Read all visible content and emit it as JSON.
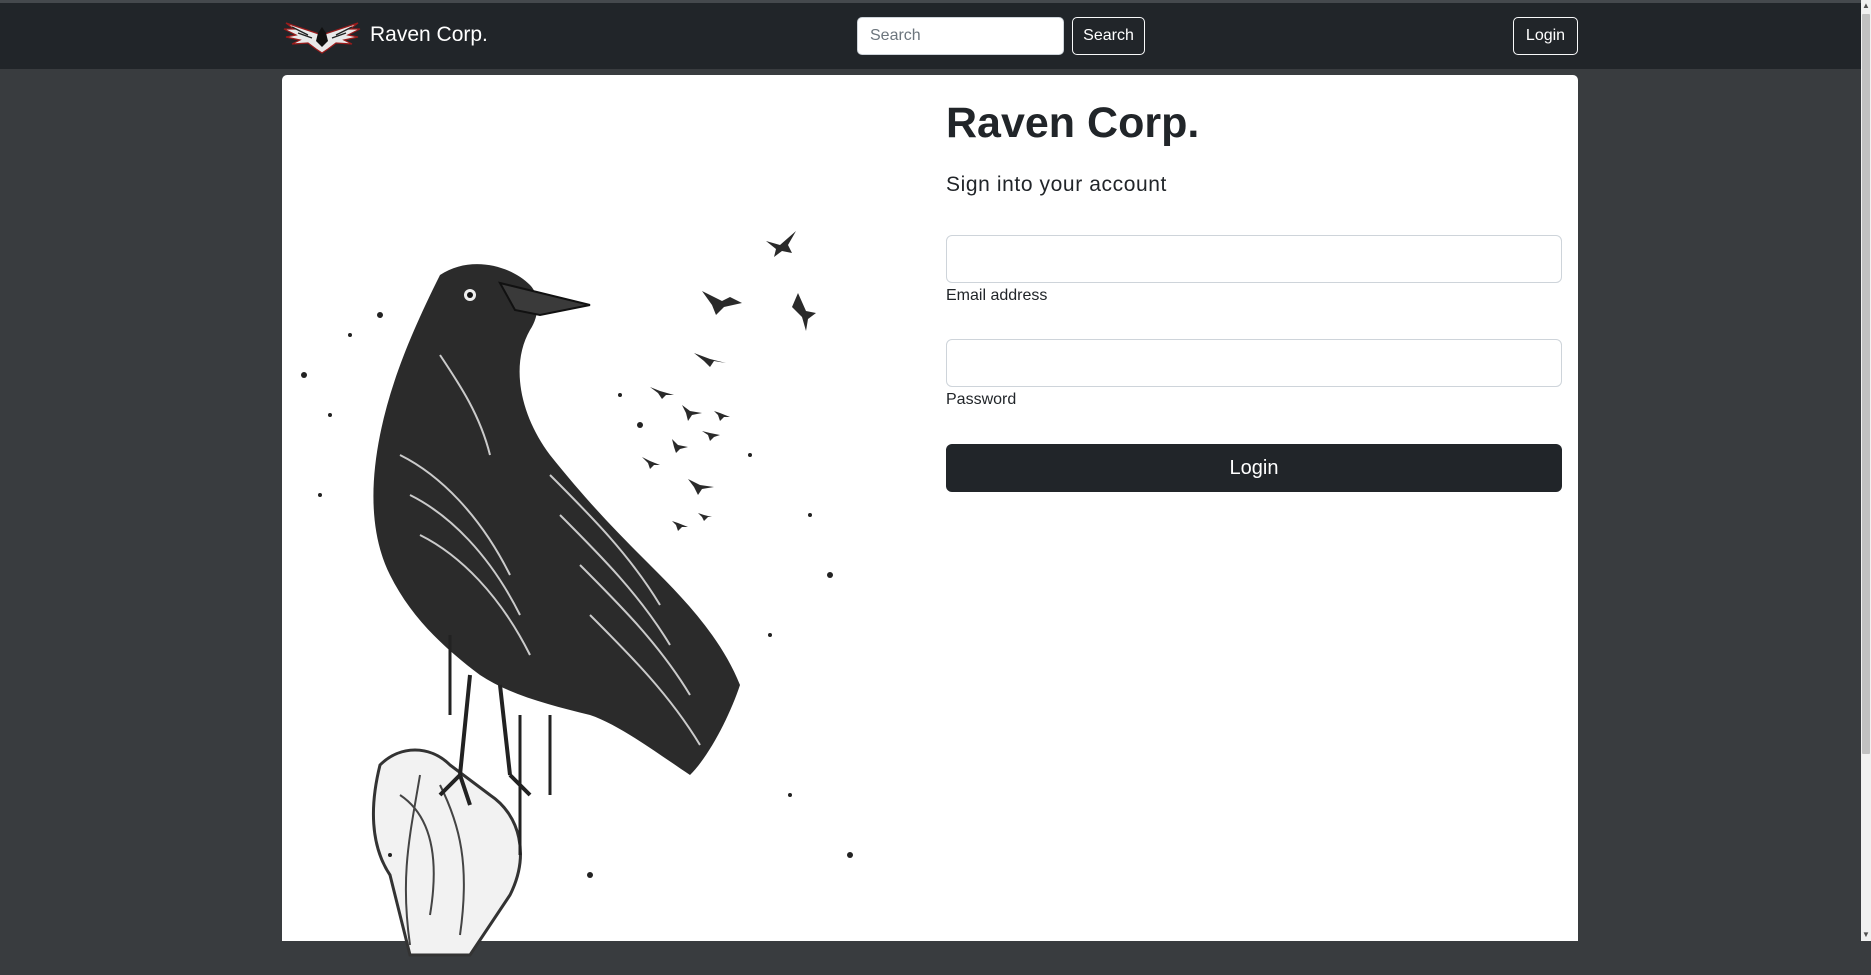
{
  "navbar": {
    "brand_logo_icon": "raven-wings-logo",
    "brand_name": "Raven Corp.",
    "search_placeholder": "Search",
    "search_button": "Search",
    "login_button": "Login"
  },
  "card": {
    "illustration": "raven-perched-on-branch-with-flock",
    "title": "Raven Corp.",
    "subtitle": "Sign into your account",
    "email_value": "",
    "email_label": "Email address",
    "password_value": "",
    "password_label": "Password",
    "login_button": "Login"
  },
  "colors": {
    "navbar_bg": "#212529",
    "page_bg": "#393c3f",
    "card_bg": "#ffffff",
    "primary_button": "#212529"
  }
}
